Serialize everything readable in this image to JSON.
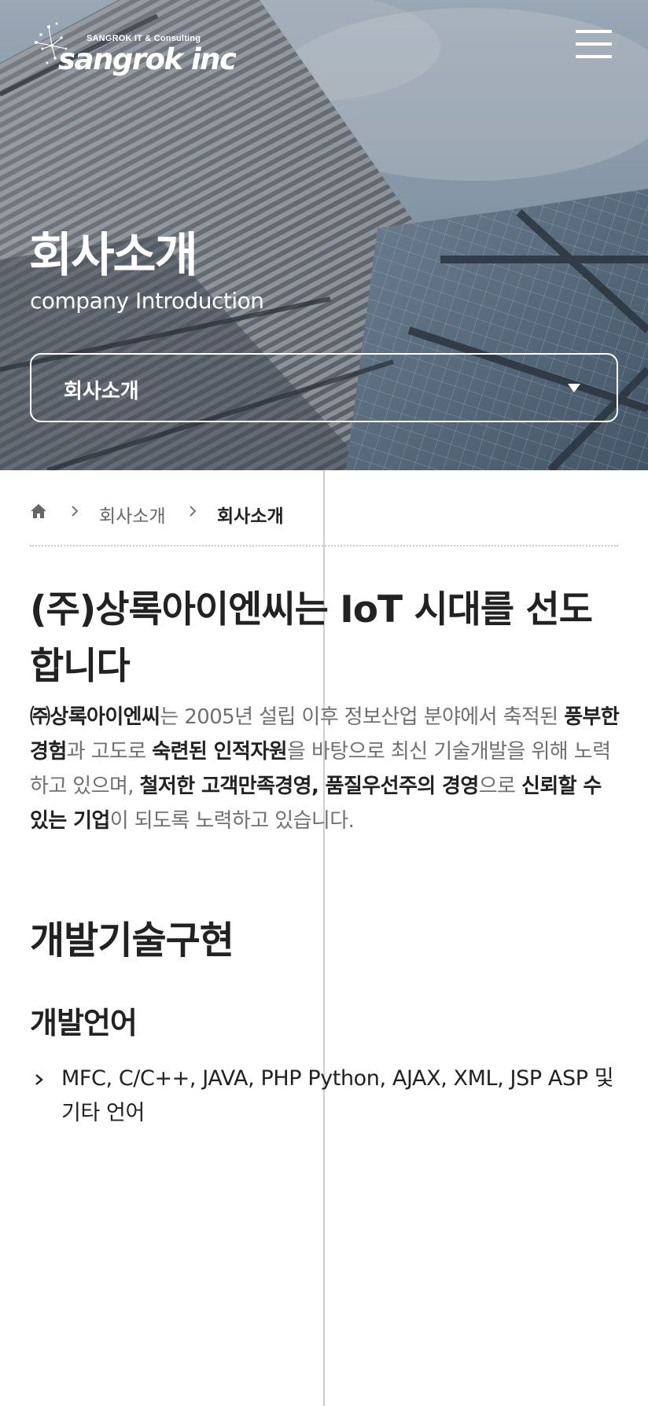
{
  "header": {
    "logo": {
      "subtitle": "SANGROK IT & Consulting",
      "wordmark": "sangrok inc"
    },
    "menu_icon": "hamburger-menu-icon"
  },
  "hero": {
    "title": "회사소개",
    "subtitle": "company Introduction",
    "select": {
      "selected": "회사소개",
      "caret_icon": "caret-down-icon"
    }
  },
  "breadcrumb": {
    "home_icon": "home-icon",
    "separator_icon": "chevron-right-icon",
    "items": [
      "회사소개",
      "회사소개"
    ]
  },
  "main": {
    "heading": "(주)상록아이엔씨는 IoT 시대를 선도합니다",
    "intro": {
      "company": "㈜상록아이엔씨",
      "t1": "는 2005년 설립 이후 정보산업 분야에서 축적된 ",
      "b1": "풍부한 경험",
      "t2": "과 고도로 ",
      "b2": "숙련된 인적자원",
      "t3": "을 바탕으로 최신 기술개발을 위해 노력하고 있으며, ",
      "b3": "철저한 고객만족경영, 품질우선주의 경영",
      "t4": "으로 ",
      "b4": "신뢰할 수 있는 기업",
      "t5": "이 되도록 노력하고 있습니다."
    },
    "section_title": "개발기술구현",
    "subsection_title": "개발언어",
    "languages": [
      "MFC, C/C++, JAVA, PHP Python, AJAX, XML, JSP ASP 및 기타 언어"
    ]
  },
  "colors": {
    "text_dark": "#222222",
    "text_muted": "#707070",
    "white": "#ffffff",
    "divider": "#c9c9c9"
  }
}
